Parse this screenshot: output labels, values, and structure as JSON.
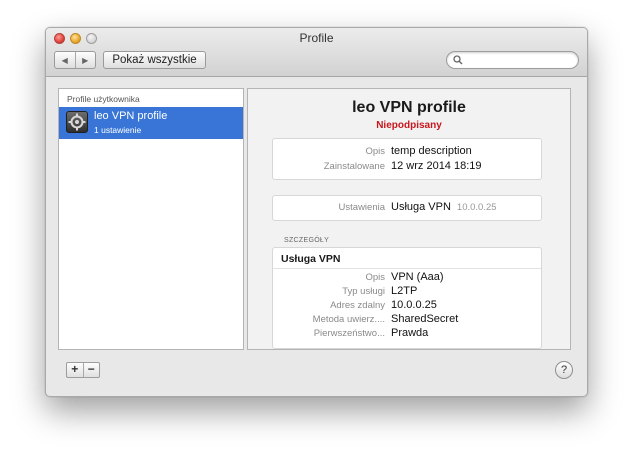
{
  "window": {
    "title": "Profile"
  },
  "toolbar": {
    "back_glyph": "◀",
    "forward_glyph": "▶",
    "show_all_label": "Pokaż wszystkie",
    "search_placeholder": "",
    "search_icon": "search-icon"
  },
  "sidebar": {
    "header": "Profile użytkownika",
    "items": [
      {
        "name": "leo VPN profile",
        "subtitle": "1 ustawienie",
        "icon": "vpn-profile-icon",
        "selected": true
      }
    ]
  },
  "footer": {
    "add_label": "+",
    "remove_label": "−",
    "help_label": "?"
  },
  "detail": {
    "title": "leo VPN profile",
    "status": "Niepodpisany",
    "summary": [
      {
        "label": "Opis",
        "value": "temp description"
      },
      {
        "label": "Zainstalowane",
        "value": "12 wrz 2014 18:19"
      }
    ],
    "settings": {
      "label": "Ustawienia",
      "value": "Usługa VPN",
      "extra": "10.0.0.25"
    },
    "details_heading": "SZCZEGÓŁY",
    "details_box": {
      "title": "Usługa VPN",
      "rows": [
        {
          "label": "Opis",
          "value": "VPN (Aaa)"
        },
        {
          "label": "Typ usługi",
          "value": "L2TP"
        },
        {
          "label": "Adres zdalny",
          "value": "10.0.0.25"
        },
        {
          "label": "Metoda uwierz....",
          "value": "SharedSecret"
        },
        {
          "label": "Pierwszeństwo...",
          "value": "Prawda"
        }
      ]
    }
  },
  "colors": {
    "selection": "#3875d7",
    "unsigned": "#c8161d"
  }
}
